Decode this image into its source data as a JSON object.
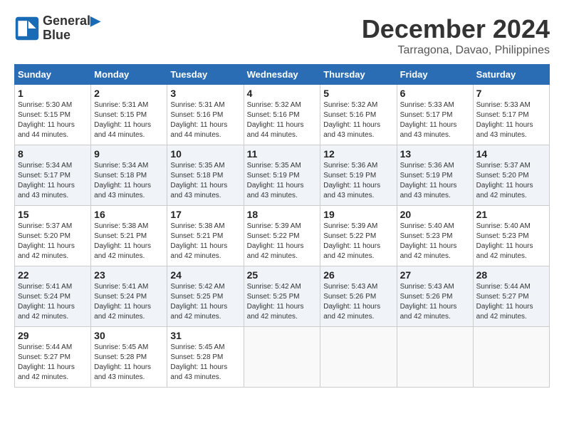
{
  "header": {
    "logo_line1": "General",
    "logo_line2": "Blue",
    "month_title": "December 2024",
    "location": "Tarragona, Davao, Philippines"
  },
  "days_of_week": [
    "Sunday",
    "Monday",
    "Tuesday",
    "Wednesday",
    "Thursday",
    "Friday",
    "Saturday"
  ],
  "weeks": [
    [
      {
        "day": 1,
        "info": "Sunrise: 5:30 AM\nSunset: 5:15 PM\nDaylight: 11 hours and 44 minutes."
      },
      {
        "day": 2,
        "info": "Sunrise: 5:31 AM\nSunset: 5:15 PM\nDaylight: 11 hours and 44 minutes."
      },
      {
        "day": 3,
        "info": "Sunrise: 5:31 AM\nSunset: 5:16 PM\nDaylight: 11 hours and 44 minutes."
      },
      {
        "day": 4,
        "info": "Sunrise: 5:32 AM\nSunset: 5:16 PM\nDaylight: 11 hours and 44 minutes."
      },
      {
        "day": 5,
        "info": "Sunrise: 5:32 AM\nSunset: 5:16 PM\nDaylight: 11 hours and 43 minutes."
      },
      {
        "day": 6,
        "info": "Sunrise: 5:33 AM\nSunset: 5:17 PM\nDaylight: 11 hours and 43 minutes."
      },
      {
        "day": 7,
        "info": "Sunrise: 5:33 AM\nSunset: 5:17 PM\nDaylight: 11 hours and 43 minutes."
      }
    ],
    [
      {
        "day": 8,
        "info": "Sunrise: 5:34 AM\nSunset: 5:17 PM\nDaylight: 11 hours and 43 minutes."
      },
      {
        "day": 9,
        "info": "Sunrise: 5:34 AM\nSunset: 5:18 PM\nDaylight: 11 hours and 43 minutes."
      },
      {
        "day": 10,
        "info": "Sunrise: 5:35 AM\nSunset: 5:18 PM\nDaylight: 11 hours and 43 minutes."
      },
      {
        "day": 11,
        "info": "Sunrise: 5:35 AM\nSunset: 5:19 PM\nDaylight: 11 hours and 43 minutes."
      },
      {
        "day": 12,
        "info": "Sunrise: 5:36 AM\nSunset: 5:19 PM\nDaylight: 11 hours and 43 minutes."
      },
      {
        "day": 13,
        "info": "Sunrise: 5:36 AM\nSunset: 5:19 PM\nDaylight: 11 hours and 43 minutes."
      },
      {
        "day": 14,
        "info": "Sunrise: 5:37 AM\nSunset: 5:20 PM\nDaylight: 11 hours and 42 minutes."
      }
    ],
    [
      {
        "day": 15,
        "info": "Sunrise: 5:37 AM\nSunset: 5:20 PM\nDaylight: 11 hours and 42 minutes."
      },
      {
        "day": 16,
        "info": "Sunrise: 5:38 AM\nSunset: 5:21 PM\nDaylight: 11 hours and 42 minutes."
      },
      {
        "day": 17,
        "info": "Sunrise: 5:38 AM\nSunset: 5:21 PM\nDaylight: 11 hours and 42 minutes."
      },
      {
        "day": 18,
        "info": "Sunrise: 5:39 AM\nSunset: 5:22 PM\nDaylight: 11 hours and 42 minutes."
      },
      {
        "day": 19,
        "info": "Sunrise: 5:39 AM\nSunset: 5:22 PM\nDaylight: 11 hours and 42 minutes."
      },
      {
        "day": 20,
        "info": "Sunrise: 5:40 AM\nSunset: 5:23 PM\nDaylight: 11 hours and 42 minutes."
      },
      {
        "day": 21,
        "info": "Sunrise: 5:40 AM\nSunset: 5:23 PM\nDaylight: 11 hours and 42 minutes."
      }
    ],
    [
      {
        "day": 22,
        "info": "Sunrise: 5:41 AM\nSunset: 5:24 PM\nDaylight: 11 hours and 42 minutes."
      },
      {
        "day": 23,
        "info": "Sunrise: 5:41 AM\nSunset: 5:24 PM\nDaylight: 11 hours and 42 minutes."
      },
      {
        "day": 24,
        "info": "Sunrise: 5:42 AM\nSunset: 5:25 PM\nDaylight: 11 hours and 42 minutes."
      },
      {
        "day": 25,
        "info": "Sunrise: 5:42 AM\nSunset: 5:25 PM\nDaylight: 11 hours and 42 minutes."
      },
      {
        "day": 26,
        "info": "Sunrise: 5:43 AM\nSunset: 5:26 PM\nDaylight: 11 hours and 42 minutes."
      },
      {
        "day": 27,
        "info": "Sunrise: 5:43 AM\nSunset: 5:26 PM\nDaylight: 11 hours and 42 minutes."
      },
      {
        "day": 28,
        "info": "Sunrise: 5:44 AM\nSunset: 5:27 PM\nDaylight: 11 hours and 42 minutes."
      }
    ],
    [
      {
        "day": 29,
        "info": "Sunrise: 5:44 AM\nSunset: 5:27 PM\nDaylight: 11 hours and 42 minutes."
      },
      {
        "day": 30,
        "info": "Sunrise: 5:45 AM\nSunset: 5:28 PM\nDaylight: 11 hours and 43 minutes."
      },
      {
        "day": 31,
        "info": "Sunrise: 5:45 AM\nSunset: 5:28 PM\nDaylight: 11 hours and 43 minutes."
      },
      null,
      null,
      null,
      null
    ]
  ]
}
